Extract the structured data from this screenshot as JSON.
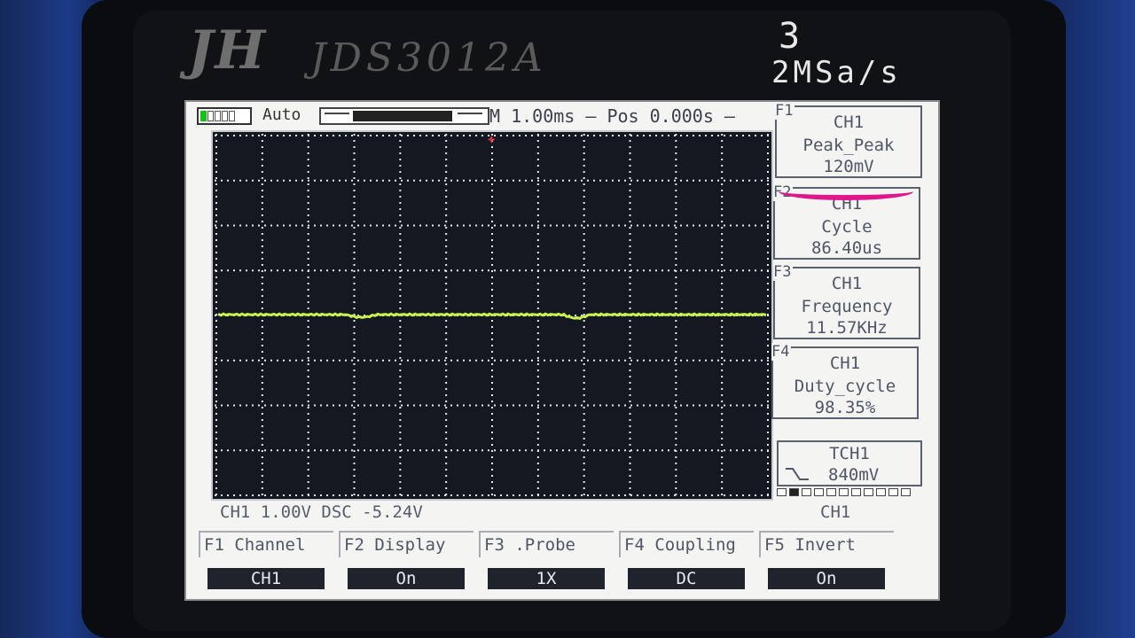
{
  "device": {
    "brand": "JH",
    "model": "JDS3012A",
    "spec_line1": "3",
    "spec_line2": "2MSa/s"
  },
  "topbar": {
    "trigger_mode": "Auto",
    "timebase": "M 1.00ms — Pos  0.000s —"
  },
  "status": {
    "channel_info": "CH1  1.00V   DSC -5.24V",
    "channel_label": "CH1"
  },
  "measurements": [
    {
      "key": "F1",
      "source": "CH1",
      "name": "Peak_Peak",
      "value": "120mV"
    },
    {
      "key": "F2",
      "source": "CH1",
      "name": "Cycle",
      "value": "86.40us"
    },
    {
      "key": "F3",
      "source": "CH1",
      "name": "Frequency",
      "value": "11.57KHz"
    },
    {
      "key": "F4",
      "source": "CH1",
      "name": "Duty_cycle",
      "value": "98.35%"
    }
  ],
  "trigger": {
    "source": "TCH1",
    "level": "840mV"
  },
  "menu": [
    {
      "label": "F1 Channel",
      "value": "CH1"
    },
    {
      "label": "F2 Display",
      "value": "On"
    },
    {
      "label": "F3 .Probe",
      "value": "1X"
    },
    {
      "label": "F4 Coupling",
      "value": "DC"
    },
    {
      "label": "F5  Invert",
      "value": "On"
    }
  ],
  "colors": {
    "trace": "#c8f050",
    "annotation": "#e0178c"
  }
}
